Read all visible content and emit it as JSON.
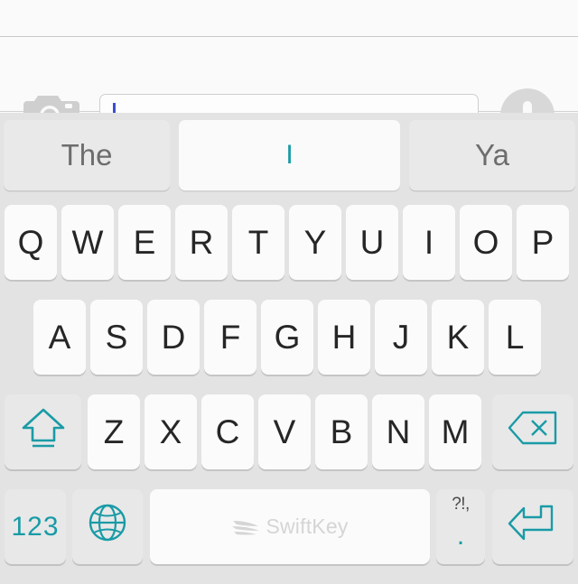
{
  "theme": {
    "accent_teal": "#199ba6",
    "keyboard_bg": "#e3e3e3",
    "key_bg": "#fbfbfb",
    "fn_key_bg": "#e8e8e8",
    "key_text": "#262626",
    "caret_blue": "#3b4ed0",
    "suggestion_text": "#6d6d6d"
  },
  "input_bar": {
    "camera_icon": "camera-icon",
    "mic_icon": "microphone-icon",
    "text_value": "",
    "placeholder": ""
  },
  "suggestions": {
    "items": [
      {
        "label": "The",
        "selected": false
      },
      {
        "label": "I",
        "selected": true
      },
      {
        "label": "Ya",
        "selected": false
      }
    ]
  },
  "keyboard": {
    "rows": [
      {
        "name": "row-qwerty",
        "keys": [
          {
            "label": "Q",
            "name": "key-q",
            "type": "letter"
          },
          {
            "label": "W",
            "name": "key-w",
            "type": "letter"
          },
          {
            "label": "E",
            "name": "key-e",
            "type": "letter"
          },
          {
            "label": "R",
            "name": "key-r",
            "type": "letter"
          },
          {
            "label": "T",
            "name": "key-t",
            "type": "letter"
          },
          {
            "label": "Y",
            "name": "key-y",
            "type": "letter"
          },
          {
            "label": "U",
            "name": "key-u",
            "type": "letter"
          },
          {
            "label": "I",
            "name": "key-i",
            "type": "letter"
          },
          {
            "label": "O",
            "name": "key-o",
            "type": "letter"
          },
          {
            "label": "P",
            "name": "key-p",
            "type": "letter"
          }
        ]
      },
      {
        "name": "row-asdf",
        "keys": [
          {
            "label": "A",
            "name": "key-a",
            "type": "letter"
          },
          {
            "label": "S",
            "name": "key-s",
            "type": "letter"
          },
          {
            "label": "D",
            "name": "key-d",
            "type": "letter"
          },
          {
            "label": "F",
            "name": "key-f",
            "type": "letter"
          },
          {
            "label": "G",
            "name": "key-g",
            "type": "letter"
          },
          {
            "label": "H",
            "name": "key-h",
            "type": "letter"
          },
          {
            "label": "J",
            "name": "key-j",
            "type": "letter"
          },
          {
            "label": "K",
            "name": "key-k",
            "type": "letter"
          },
          {
            "label": "L",
            "name": "key-l",
            "type": "letter"
          }
        ]
      },
      {
        "name": "row-zxcv",
        "keys": [
          {
            "label": "",
            "name": "key-shift",
            "type": "function",
            "icon": "shift-arrow-icon"
          },
          {
            "label": "Z",
            "name": "key-z",
            "type": "letter"
          },
          {
            "label": "X",
            "name": "key-x",
            "type": "letter"
          },
          {
            "label": "C",
            "name": "key-c",
            "type": "letter"
          },
          {
            "label": "V",
            "name": "key-v",
            "type": "letter"
          },
          {
            "label": "B",
            "name": "key-b",
            "type": "letter"
          },
          {
            "label": "N",
            "name": "key-n",
            "type": "letter"
          },
          {
            "label": "M",
            "name": "key-m",
            "type": "letter"
          },
          {
            "label": "",
            "name": "key-backspace",
            "type": "function",
            "icon": "backspace-icon"
          }
        ]
      },
      {
        "name": "row-bottom",
        "keys": [
          {
            "label": "123",
            "name": "key-numeric-mode",
            "type": "function"
          },
          {
            "label": "",
            "name": "key-language-globe",
            "type": "function",
            "icon": "globe-icon"
          },
          {
            "label": "SwiftKey",
            "name": "key-space",
            "type": "space",
            "icon": "swiftkey-logo-icon"
          },
          {
            "label": ".",
            "name": "key-punctuation",
            "type": "punctuation",
            "secondary_label": "?!,"
          },
          {
            "label": "",
            "name": "key-enter",
            "type": "function",
            "icon": "return-arrow-icon"
          }
        ]
      }
    ]
  }
}
